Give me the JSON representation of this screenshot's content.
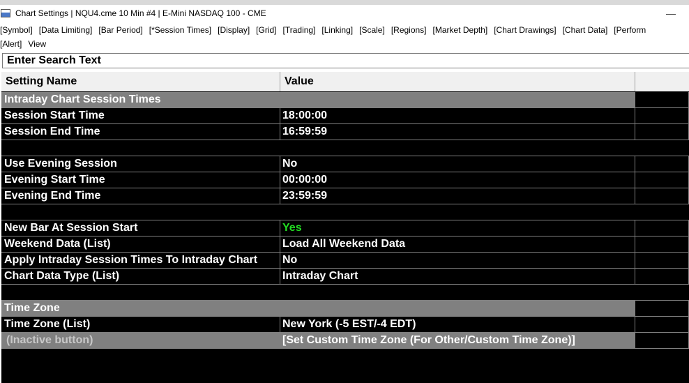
{
  "window": {
    "title": "Chart Settings | NQU4.cme  10 Min  #4 | E-Mini NASDAQ 100 - CME",
    "minimize_glyph": "—"
  },
  "menu": {
    "row1": [
      "[Symbol]",
      "[Data Limiting]",
      "[Bar Period]",
      "[*Session Times]",
      "[Display]",
      "[Grid]",
      "[Trading]",
      "[Linking]",
      "[Scale]",
      "[Regions]",
      "[Market Depth]",
      "[Chart Drawings]",
      "[Chart Data]",
      "[Perform"
    ],
    "row2": [
      "[Alert]",
      "View"
    ]
  },
  "search": {
    "placeholder": "Enter Search Text"
  },
  "table": {
    "headers": {
      "name": "Setting Name",
      "value": "Value"
    },
    "sections": {
      "intraday": "Intraday Chart Session Times",
      "timezone": "Time Zone"
    },
    "rows": {
      "session_start": {
        "name": "Session Start Time",
        "value": "18:00:00"
      },
      "session_end": {
        "name": "Session End Time",
        "value": "16:59:59"
      },
      "use_evening": {
        "name": "Use Evening Session",
        "value": "No"
      },
      "evening_start": {
        "name": "Evening Start Time",
        "value": "00:00:00"
      },
      "evening_end": {
        "name": "Evening End Time",
        "value": "23:59:59"
      },
      "new_bar": {
        "name": "New Bar At Session Start",
        "value": "Yes"
      },
      "weekend": {
        "name": "Weekend Data (List)",
        "value": "Load All Weekend Data"
      },
      "apply_intraday": {
        "name": "Apply Intraday Session Times To Intraday Chart",
        "value": "No"
      },
      "chart_type": {
        "name": "Chart Data Type (List)",
        "value": "Intraday Chart"
      },
      "tz": {
        "name": "Time Zone (List)",
        "value": "New York (-5 EST/-4 EDT)"
      },
      "inactive": {
        "name": "(Inactive button)",
        "value": "[Set Custom Time Zone (For Other/Custom Time Zone)]"
      }
    },
    "colors": {
      "yes_value": "#22dd22",
      "section_bg": "#808080",
      "grid_bg": "#000000"
    }
  }
}
